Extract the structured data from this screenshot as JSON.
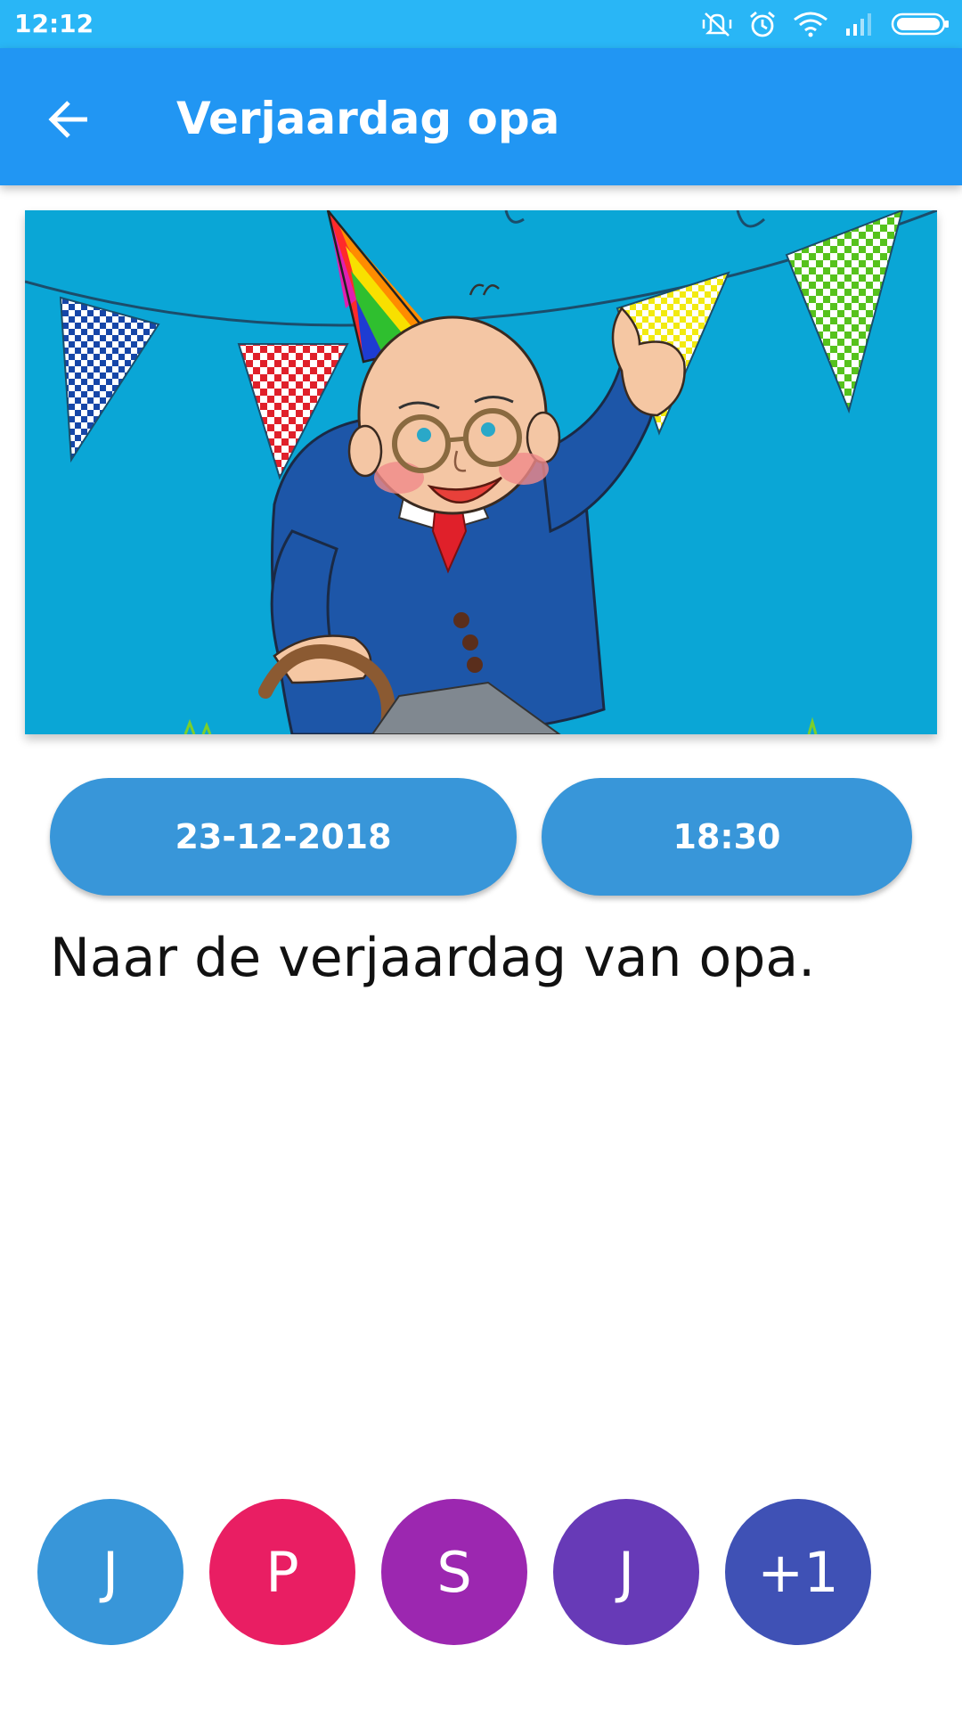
{
  "status_bar": {
    "time": "12:12",
    "icons": [
      "mute-vibrate-icon",
      "alarm-icon",
      "wifi-icon",
      "signal-icon",
      "battery-icon"
    ]
  },
  "app_bar": {
    "title": "Verjaardag opa",
    "back_icon": "arrow-back-icon",
    "color": "#2196f3"
  },
  "event": {
    "image": "birthday-grandpa-illustration",
    "date": "23-12-2018",
    "time": "18:30",
    "description": "Naar de verjaardag van opa."
  },
  "participants": [
    {
      "initial": "J",
      "color": "#3896d9"
    },
    {
      "initial": "P",
      "color": "#e91e63"
    },
    {
      "initial": "S",
      "color": "#9c27b0"
    },
    {
      "initial": "J",
      "color": "#673ab7"
    },
    {
      "initial": "+1",
      "color": "#3f51b5"
    }
  ]
}
